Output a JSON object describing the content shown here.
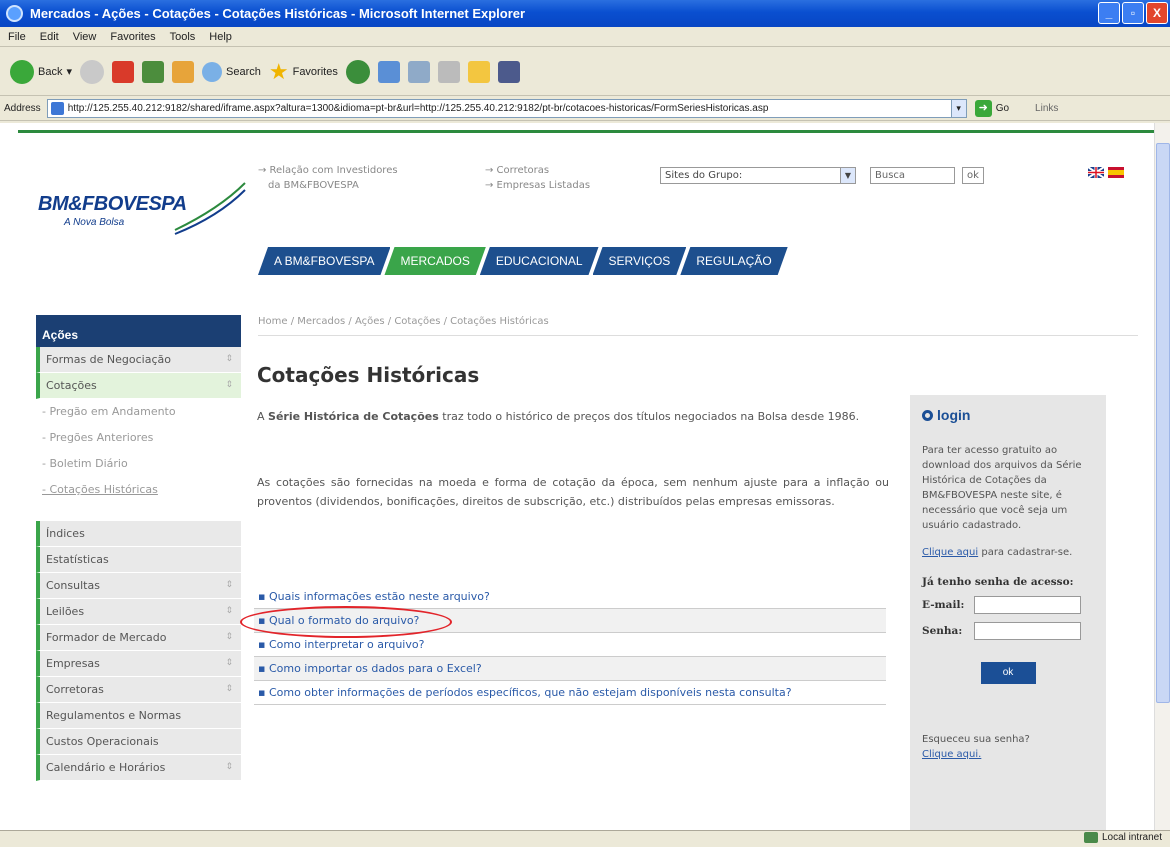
{
  "window": {
    "title": "Mercados - Ações - Cotações - Cotações Históricas - Microsoft Internet Explorer",
    "controls": [
      "_",
      "▫",
      "X"
    ]
  },
  "menu": [
    "File",
    "Edit",
    "View",
    "Favorites",
    "Tools",
    "Help"
  ],
  "toolbar": {
    "back": "Back",
    "search": "Search",
    "favorites": "Favorites"
  },
  "address": {
    "label": "Address",
    "url": "http://125.255.40.212:9182/shared/iframe.aspx?altura=1300&idioma=pt-br&url=http://125.255.40.212:9182/pt-br/cotacoes-historicas/FormSeriesHistoricas.asp",
    "go": "Go",
    "links": "Links"
  },
  "header": {
    "logo_name": "BM&FBOVESPA",
    "logo_tag": "A Nova Bolsa",
    "links_col1": [
      "→ Relação com Investidores",
      "da BM&FBOVESPA"
    ],
    "links_col2": [
      "→ Corretoras",
      "→ Empresas Listadas"
    ],
    "sites_select": "Sites do Grupo:",
    "search_placeholder": "Busca",
    "search_ok": "ok",
    "tabs": [
      "A BM&FBOVESPA",
      "MERCADOS",
      "EDUCACIONAL",
      "SERVIÇOS",
      "REGULAÇÃO"
    ]
  },
  "sidebar": {
    "heading": "Ações",
    "group1": [
      {
        "label": "Formas de Negociação"
      },
      {
        "label": "Cotações"
      }
    ],
    "subitems": [
      "- Pregão em Andamento",
      "- Pregões Anteriores",
      "- Boletim Diário",
      "- Cotações Históricas"
    ],
    "group2": [
      {
        "label": "Índices"
      },
      {
        "label": "Estatísticas"
      },
      {
        "label": "Consultas"
      },
      {
        "label": "Leilões"
      },
      {
        "label": "Formador de Mercado"
      },
      {
        "label": "Empresas"
      },
      {
        "label": "Corretoras"
      },
      {
        "label": "Regulamentos e Normas"
      },
      {
        "label": "Custos Operacionais"
      },
      {
        "label": "Calendário e Horários"
      }
    ]
  },
  "main": {
    "breadcrumb": "Home / Mercados / Ações / Cotações / Cotações Históricas",
    "title": "Cotações Históricas",
    "para1_bold": "Série Histórica de Cotações",
    "para1_pre": "A",
    "para1_post": "traz todo o histórico de preços dos títulos negociados na Bolsa desde 1986.",
    "para2": "As cotações são fornecidas na moeda e forma de cotação da época, sem nenhum ajuste para a inflação ou proventos (dividendos, bonificações, direitos de subscrição, etc.) distribuídos pelas empresas emissoras.",
    "faq": [
      "Quais informações estão neste arquivo?",
      "Qual o formato do arquivo?",
      "Como interpretar o arquivo?",
      "Como importar os dados para o Excel?",
      "Como obter informações de períodos específicos, que não estejam disponíveis nesta consulta?"
    ]
  },
  "login": {
    "title": "login",
    "text": "Para ter acesso gratuito ao download dos arquivos da Série Histórica de Cotações da BM&FBOVESPA neste site, é necessário que você seja um usuário cadastrado.",
    "register_link": "Clique aqui",
    "register_rest": "para cadastrar-se.",
    "has_password": "Já tenho senha de acesso:",
    "email_label": "E-mail:",
    "password_label": "Senha:",
    "ok": "ok",
    "forgot": "Esqueceu sua senha?",
    "forgot_link": "Clique aqui."
  },
  "status": {
    "zone": "Local intranet"
  },
  "colors": {
    "brand_blue": "#1b3f73",
    "brand_green": "#3aa54a",
    "highlight_red": "#e2242a"
  }
}
